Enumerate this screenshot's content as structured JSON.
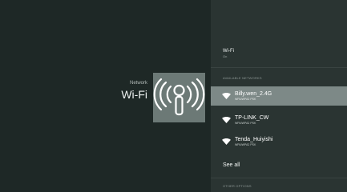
{
  "left": {
    "subtitle": "Network",
    "title": "Wi-Fi",
    "hero_icon": "wifi-antenna-icon"
  },
  "header": {
    "title": "Wi-Fi",
    "status": "On"
  },
  "sections": {
    "available": "AVAILABLE NETWORKS",
    "other": "OTHER OPTIONS"
  },
  "networks": [
    {
      "name": "Billy.wen_2.4G",
      "security": "WPA/WPA2 PSK",
      "icon": "wifi-signal-icon",
      "selected": true
    },
    {
      "name": "TP-LINK_CW",
      "security": "WPA/WPA2 PSK",
      "icon": "wifi-signal-icon",
      "selected": false
    },
    {
      "name": "Tenda_Huiyishi",
      "security": "WPA/WPA2 PSK",
      "icon": "wifi-signal-icon",
      "selected": false
    }
  ],
  "see_all": "See all",
  "colors": {
    "background": "#1e2826",
    "panel": "#2a3432",
    "hero_tile": "#6c7976",
    "selected_row": "#7d8987"
  }
}
